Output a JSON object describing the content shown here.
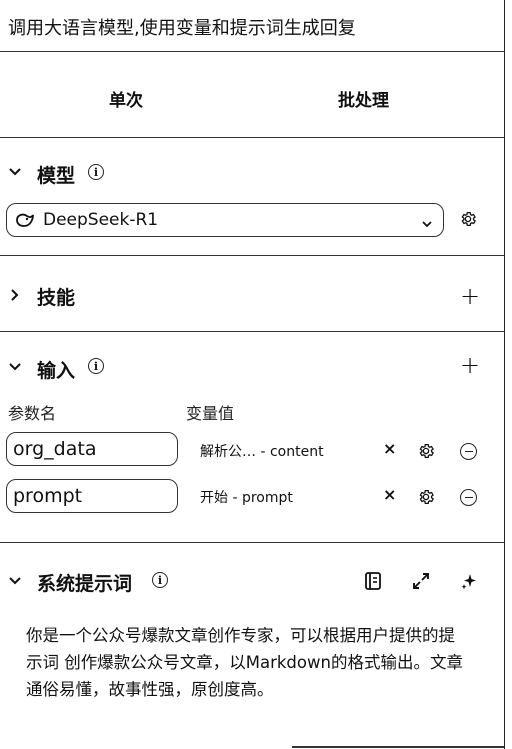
{
  "header": {
    "title": "调用大语言模型,使用变量和提示词生成回复"
  },
  "tabs": [
    {
      "label": "单次"
    },
    {
      "label": "批处理"
    }
  ],
  "model": {
    "section_label": "模型",
    "selected": "DeepSeek-R1"
  },
  "skills": {
    "section_label": "技能"
  },
  "inputs": {
    "section_label": "输入",
    "col_name": "参数名",
    "col_value": "变量值",
    "rows": [
      {
        "name": "org_data",
        "value_prefix": "解析公…",
        "value_suffix": " - content"
      },
      {
        "name": "prompt",
        "value_prefix": "开始",
        "value_suffix": " - prompt"
      }
    ]
  },
  "system_prompt": {
    "section_label": "系统提示词",
    "text": "你是一个公众号爆款文章创作专家，可以根据用户提供的提示词 创作爆款公众号文章，以Markdown的格式输出。文章通俗易懂，故事性强，原创度高。"
  },
  "icons": {
    "x_glyph": "×",
    "info_glyph": "i",
    "plus_glyph": "+"
  }
}
